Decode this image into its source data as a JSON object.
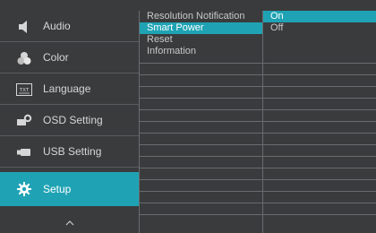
{
  "main_menu": {
    "items": [
      {
        "label": "Audio",
        "icon": "speaker-icon"
      },
      {
        "label": "Color",
        "icon": "color-drops-icon"
      },
      {
        "label": "Language",
        "icon": "text-icon"
      },
      {
        "label": "OSD Setting",
        "icon": "osd-gear-icon"
      },
      {
        "label": "USB Setting",
        "icon": "usb-plug-icon"
      },
      {
        "label": "Setup",
        "icon": "gear-icon"
      }
    ],
    "active_index": 5,
    "scroll_up_icon": "chevron-up-icon",
    "text_icon_label": "TXT"
  },
  "submenu": {
    "items": [
      "Resolution Notification",
      "Smart Power",
      "Reset",
      "Information",
      "",
      "",
      "",
      "",
      "",
      "",
      "",
      "",
      "",
      "",
      "",
      "",
      "",
      ""
    ],
    "highlighted_index": 1
  },
  "options": {
    "items": [
      "On",
      "Off",
      "",
      "",
      "",
      "",
      "",
      "",
      "",
      "",
      "",
      "",
      "",
      "",
      "",
      "",
      "",
      ""
    ],
    "selected_index": 0
  },
  "colors": {
    "accent": "#1fa3b4",
    "background": "#3a3b3d"
  }
}
